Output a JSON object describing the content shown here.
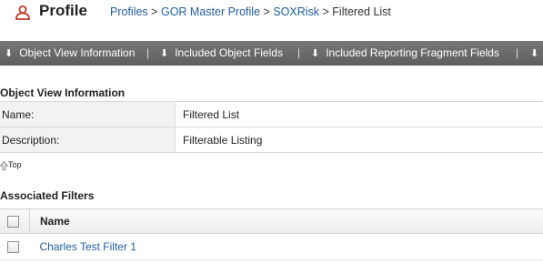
{
  "header": {
    "title": "Profile",
    "icon": "profile-icon",
    "breadcrumb": [
      {
        "label": "Profiles",
        "link": true
      },
      {
        "label": "GOR Master Profile",
        "link": true
      },
      {
        "label": "SOXRisk",
        "link": true
      },
      {
        "label": "Filtered List",
        "link": false
      }
    ],
    "separator": ">"
  },
  "navbar": {
    "items": [
      {
        "label": "Object View Information",
        "icon": "down-arrow-icon"
      },
      {
        "label": "Included Object Fields",
        "icon": "down-arrow-icon"
      },
      {
        "label": "Included Reporting Fragment Fields",
        "icon": "down-arrow-icon"
      }
    ],
    "divider": "|"
  },
  "object_view": {
    "title": "Object View Information",
    "rows": [
      {
        "label": "Name:",
        "value": "Filtered List"
      },
      {
        "label": "Description:",
        "value": "Filterable Listing"
      }
    ]
  },
  "top_link": {
    "label": "Top",
    "icon": "up-arrow-icon"
  },
  "filters": {
    "title": "Associated Filters",
    "column_name": "Name",
    "rows": [
      {
        "name": "Charles Test Filter 1"
      }
    ]
  },
  "colors": {
    "link": "#1f5e9c",
    "navbar": "#666666"
  }
}
